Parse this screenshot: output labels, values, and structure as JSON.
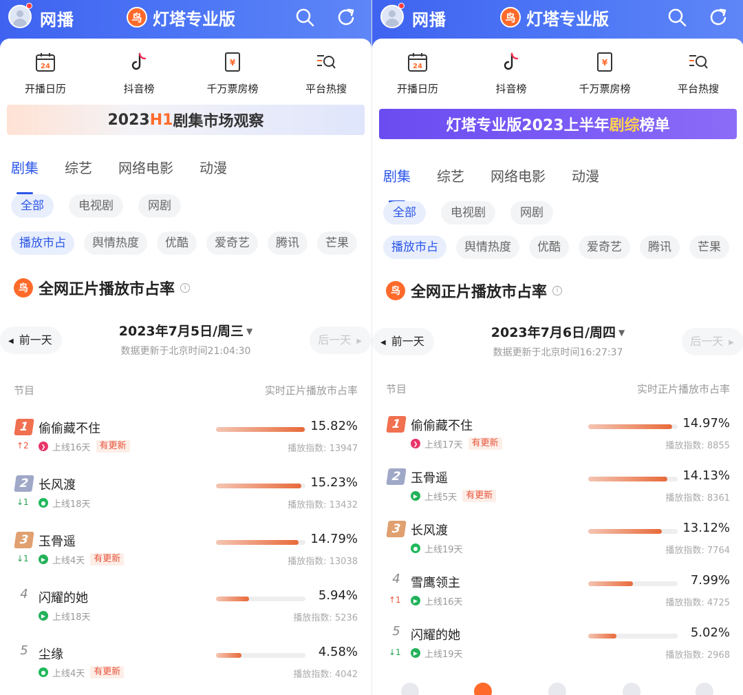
{
  "panels": [
    {
      "header": {
        "app_name": "网播",
        "brand_logo_char": "鸟",
        "brand_name": "灯塔专业版"
      },
      "quicknav": [
        "开播日历",
        "抖音榜",
        "千万票房榜",
        "平台热搜"
      ],
      "calendar_icon_day": "24",
      "banner": {
        "text": "2023H1剧集市场观察",
        "highlight": "H1",
        "prefix": "2023",
        "suffix": "剧集市场观察"
      },
      "tabs": [
        "剧集",
        "综艺",
        "网络电影",
        "动漫"
      ],
      "type_chips": [
        "全部",
        "电视剧",
        "网剧"
      ],
      "metric_chips": [
        "播放市占",
        "舆情热度",
        "优酷",
        "爱奇艺",
        "腾讯",
        "芒果"
      ],
      "section_title": "全网正片播放市占率",
      "prev_day": "前一天",
      "next_day": "后一天",
      "date": "2023年7月5日/周三",
      "updated": "数据更新于北京时间21:04:30",
      "col_left": "节目",
      "col_right": "实时正片播放市占率",
      "index_label": "播放指数:",
      "new_tag": "有更新",
      "ranks": [
        {
          "rank": "1",
          "title": "偷偷藏不住",
          "change": "↑2",
          "dir": "up",
          "platform": "iqiyi-icon",
          "online": "上线16天",
          "has_new": true,
          "pct": "15.82%",
          "share": 15.82,
          "index": "13947"
        },
        {
          "rank": "2",
          "title": "长风渡",
          "change": "↓1",
          "dir": "down",
          "platform": "youku-icon",
          "online": "上线18天",
          "has_new": false,
          "pct": "15.23%",
          "share": 15.23,
          "index": "13432"
        },
        {
          "rank": "3",
          "title": "玉骨遥",
          "change": "↓1",
          "dir": "down",
          "platform": "tencent-icon",
          "online": "上线4天",
          "has_new": true,
          "pct": "14.79%",
          "share": 14.79,
          "index": "13038"
        },
        {
          "rank": "4",
          "title": "闪耀的她",
          "change": "",
          "dir": "",
          "platform": "tencent-icon",
          "online": "上线18天",
          "has_new": false,
          "pct": "5.94%",
          "share": 5.94,
          "index": "5236"
        },
        {
          "rank": "5",
          "title": "尘缘",
          "change": "",
          "dir": "",
          "platform": "youku-icon",
          "online": "上线4天",
          "has_new": true,
          "pct": "4.58%",
          "share": 4.58,
          "index": "4042"
        }
      ]
    },
    {
      "header": {
        "app_name": "网播",
        "brand_logo_char": "鸟",
        "brand_name": "灯塔专业版"
      },
      "quicknav": [
        "开播日历",
        "抖音榜",
        "千万票房榜",
        "平台热搜"
      ],
      "calendar_icon_day": "24",
      "banner": {
        "text": "灯塔专业版2023上半年剧综榜单",
        "prefix": "灯塔专业版2023上半年",
        "highlight": "剧综",
        "suffix": "榜单"
      },
      "tabs": [
        "剧集",
        "综艺",
        "网络电影",
        "动漫"
      ],
      "type_chips": [
        "全部",
        "电视剧",
        "网剧"
      ],
      "metric_chips": [
        "播放市占",
        "舆情热度",
        "优酷",
        "爱奇艺",
        "腾讯",
        "芒果"
      ],
      "section_title": "全网正片播放市占率",
      "prev_day": "前一天",
      "next_day": "后一天",
      "date": "2023年7月6日/周四",
      "updated": "数据更新于北京时间16:27:37",
      "col_left": "节目",
      "col_right": "实时正片播放市占率",
      "index_label": "播放指数:",
      "new_tag": "有更新",
      "ranks": [
        {
          "rank": "1",
          "title": "偷偷藏不住",
          "change": "",
          "dir": "",
          "platform": "iqiyi-icon",
          "online": "上线17天",
          "has_new": true,
          "pct": "14.97%",
          "share": 14.97,
          "index": "8855"
        },
        {
          "rank": "2",
          "title": "玉骨遥",
          "change": "",
          "dir": "",
          "platform": "tencent-icon",
          "online": "上线5天",
          "has_new": true,
          "pct": "14.13%",
          "share": 14.13,
          "index": "8361"
        },
        {
          "rank": "3",
          "title": "长风渡",
          "change": "",
          "dir": "",
          "platform": "youku-icon",
          "online": "上线19天",
          "has_new": false,
          "pct": "13.12%",
          "share": 13.12,
          "index": "7764"
        },
        {
          "rank": "4",
          "title": "雪鹰领主",
          "change": "↑1",
          "dir": "up",
          "platform": "tencent-icon",
          "online": "上线16天",
          "has_new": false,
          "pct": "7.99%",
          "share": 7.99,
          "index": "4725"
        },
        {
          "rank": "5",
          "title": "闪耀的她",
          "change": "↓1",
          "dir": "down",
          "platform": "tencent-icon",
          "online": "上线19天",
          "has_new": false,
          "pct": "5.02%",
          "share": 5.02,
          "index": "2968"
        }
      ]
    }
  ],
  "colors": {
    "header": "#4568f2",
    "accent": "#2b56e8",
    "orange": "#ff6a2b",
    "bar": "#e86a3a",
    "up": "#e8543a",
    "down": "#22a050",
    "rank1": "#f07050",
    "rank2": "#a0a8c8",
    "rank3": "#e0a070"
  },
  "platform_colors": {
    "iqiyi-icon": "#e8366a",
    "youku-icon": "#1fb95a",
    "tencent-icon": "#23b25a"
  }
}
